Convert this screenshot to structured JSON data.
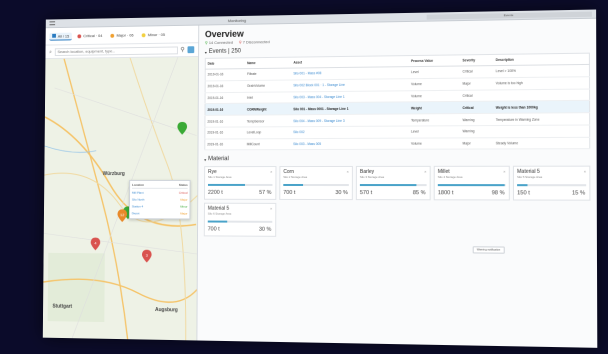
{
  "window": {
    "title": "Monitoring",
    "tab_right": "Events"
  },
  "filters": [
    {
      "label": "All / 15",
      "color": "#2a7bc0"
    },
    {
      "label": "Critical · 04",
      "color": "#d9534f"
    },
    {
      "label": "Major · 06",
      "color": "#f0a030"
    },
    {
      "label": "Minor · 05",
      "color": "#f2d040"
    }
  ],
  "search": {
    "placeholder": "Search location, equipment, type..."
  },
  "map": {
    "cities": [
      {
        "label": "Würzburg"
      },
      {
        "label": "Stuttgart"
      },
      {
        "label": "Augsburg"
      }
    ],
    "pins": [
      {
        "color": "#3aaa35",
        "label": ""
      },
      {
        "color": "#3aaa35",
        "label": ""
      },
      {
        "color": "#e8892a",
        "label": "12"
      },
      {
        "color": "#d9534f",
        "label": "4"
      },
      {
        "color": "#d9534f",
        "label": "3"
      }
    ],
    "popup": {
      "headers": [
        "Location",
        "Status"
      ],
      "rows": [
        {
          "name": "Mill Plant",
          "status": "Critical",
          "color": "#d9534f"
        },
        {
          "name": "Silo North",
          "status": "Major",
          "color": "#f0a030"
        },
        {
          "name": "Station 4",
          "status": "Minor",
          "color": "#3aaa35"
        },
        {
          "name": "Depot",
          "status": "Major",
          "color": "#f0a030"
        }
      ]
    }
  },
  "overview": {
    "title": "Overview",
    "legend": [
      "14 Connected",
      "7 Disconnected"
    ],
    "events_label": "Events | 250",
    "columns": [
      "Date",
      "Name",
      "Asset",
      "Process Value",
      "Severity",
      "Description"
    ],
    "rows": [
      {
        "date": "2019-01-16",
        "name": "Filtrate",
        "asset": "Silo 001 - Mass #08",
        "value": "Level",
        "severity": "Critical",
        "desc": "Level > 100%"
      },
      {
        "date": "2019-01-16",
        "name": "GrainVolume",
        "asset": "Silo 002 Block 001 · 1 - Storage Line",
        "value": "Volume",
        "severity": "Major",
        "desc": "Volume is too high"
      },
      {
        "date": "2019-01-16",
        "name": "Inlet",
        "asset": "Silo 003 - Mass 004 - Storage Line 1",
        "value": "Volume",
        "severity": "Critical",
        "desc": ""
      },
      {
        "date": "2019-01-16",
        "name": "CORNWeight",
        "asset": "Silo 001 - Mass 0001 - Storage Line 1",
        "value": "Weight",
        "severity": "Critical",
        "desc": "Weight is less than 1000kg"
      },
      {
        "date": "2019-01-16",
        "name": "TempSensor",
        "asset": "Silo 004 - Mass 009 - Storage Line 3",
        "value": "Temperature",
        "severity": "Warning",
        "desc": "Temperature in Warning Zone"
      },
      {
        "date": "2019-01-16",
        "name": "LevelLoop",
        "asset": "Silo 002",
        "value": "Level",
        "severity": "Warning",
        "desc": ""
      },
      {
        "date": "2019-01-16",
        "name": "MillCount",
        "asset": "Silo 003 - Mass 005",
        "value": "Volume",
        "severity": "Major",
        "desc": "Steady Volume"
      }
    ]
  },
  "material": {
    "label": "Material",
    "items": [
      {
        "name": "Rye",
        "sub": "Silo 1 Storage Area",
        "value": "2200 t",
        "pct": "57 %",
        "fill": 0.57
      },
      {
        "name": "Corn",
        "sub": "Silo 2 Storage Area",
        "value": "700 t",
        "pct": "30 %",
        "fill": 0.3
      },
      {
        "name": "Barley",
        "sub": "Silo 3 Storage Area",
        "value": "570 t",
        "pct": "85 %",
        "fill": 0.85
      },
      {
        "name": "Millet",
        "sub": "Silo 4 Storage Area",
        "value": "1800 t",
        "pct": "98 %",
        "fill": 0.98
      },
      {
        "name": "Material 5",
        "sub": "Silo 5 Storage Area",
        "value": "150 t",
        "pct": "15 %",
        "fill": 0.15
      },
      {
        "name": "Material 5",
        "sub": "Silo 6 Storage Area",
        "value": "700 t",
        "pct": "30 %",
        "fill": 0.3
      }
    ],
    "tooltip": "Warning notification"
  }
}
